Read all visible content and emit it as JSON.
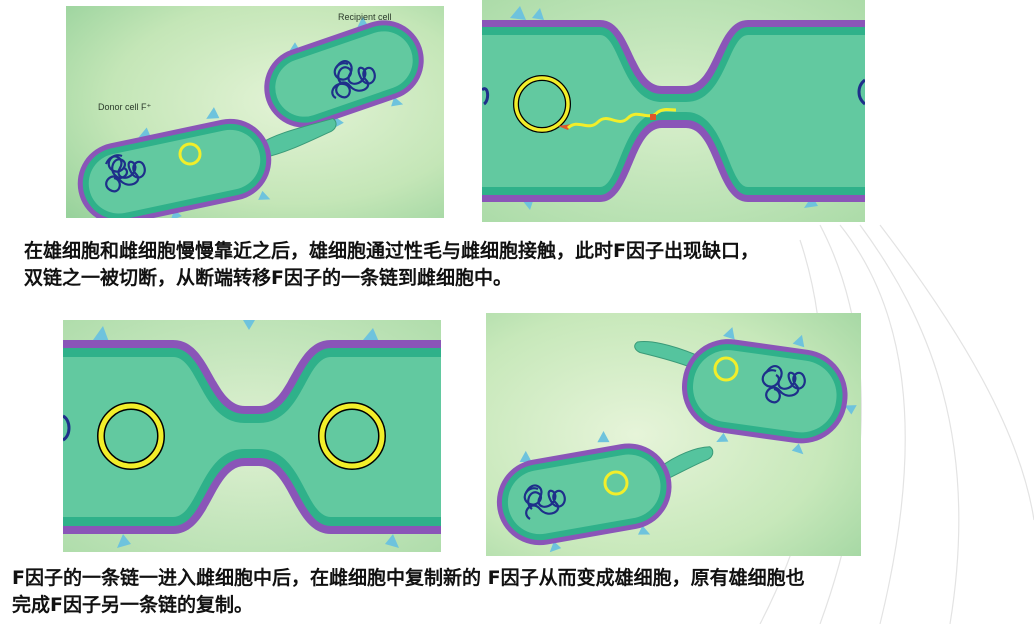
{
  "panels": [
    {
      "id": "approach",
      "labels": {
        "recipient": "Recipient cell",
        "donor": "Donor cell F⁺"
      }
    },
    {
      "id": "transfer"
    },
    {
      "id": "replication"
    },
    {
      "id": "result"
    }
  ],
  "captions": {
    "top_line1": "在雄细胞和雌细胞慢慢靠近之后，雄细胞通过性毛与雌细胞接触，此时F因子出现缺口，",
    "top_line2": "双链之一被切断，从断端转移F因子的一条链到雌细胞中。",
    "bottom_line1": "F因子的一条链一进入雌细胞中后，在雌细胞中复制新的 F因子从而变成雄细胞，原有雄细胞也",
    "bottom_line2": "完成F因子另一条链的复制。"
  },
  "colors": {
    "membrane_outer": "#8a55b8",
    "membrane_inner": "#2fb18a",
    "cytoplasm": "#62c9a0",
    "plasmid": "#f2ee2a",
    "chromosome": "#1e2f8a",
    "pilus": "#55c49e",
    "spike": "#6ec3dd",
    "nick": "#e0572a"
  },
  "icons": [
    "bacterium-cell",
    "f-plasmid-ring",
    "chromosome-coil",
    "sex-pilus"
  ]
}
